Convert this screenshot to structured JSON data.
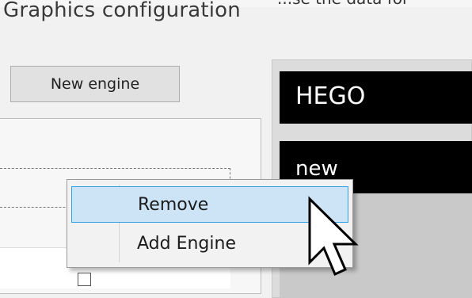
{
  "window": {
    "title": "Graphics configuration",
    "top_strip_text": "...se the data for"
  },
  "toolbar": {
    "new_engine_label": "New engine"
  },
  "engines": [
    {
      "name": "HEGO"
    },
    {
      "name": "new"
    }
  ],
  "context_menu": {
    "items": [
      {
        "label": "Remove",
        "highlighted": true
      },
      {
        "label": "Add Engine",
        "highlighted": false
      }
    ]
  },
  "colors": {
    "menu_highlight": "#cde4f6",
    "menu_highlight_border": "#35a0e0",
    "engine_tile": "#000000"
  },
  "icons": {
    "cursor": "arrow-cursor-icon"
  }
}
